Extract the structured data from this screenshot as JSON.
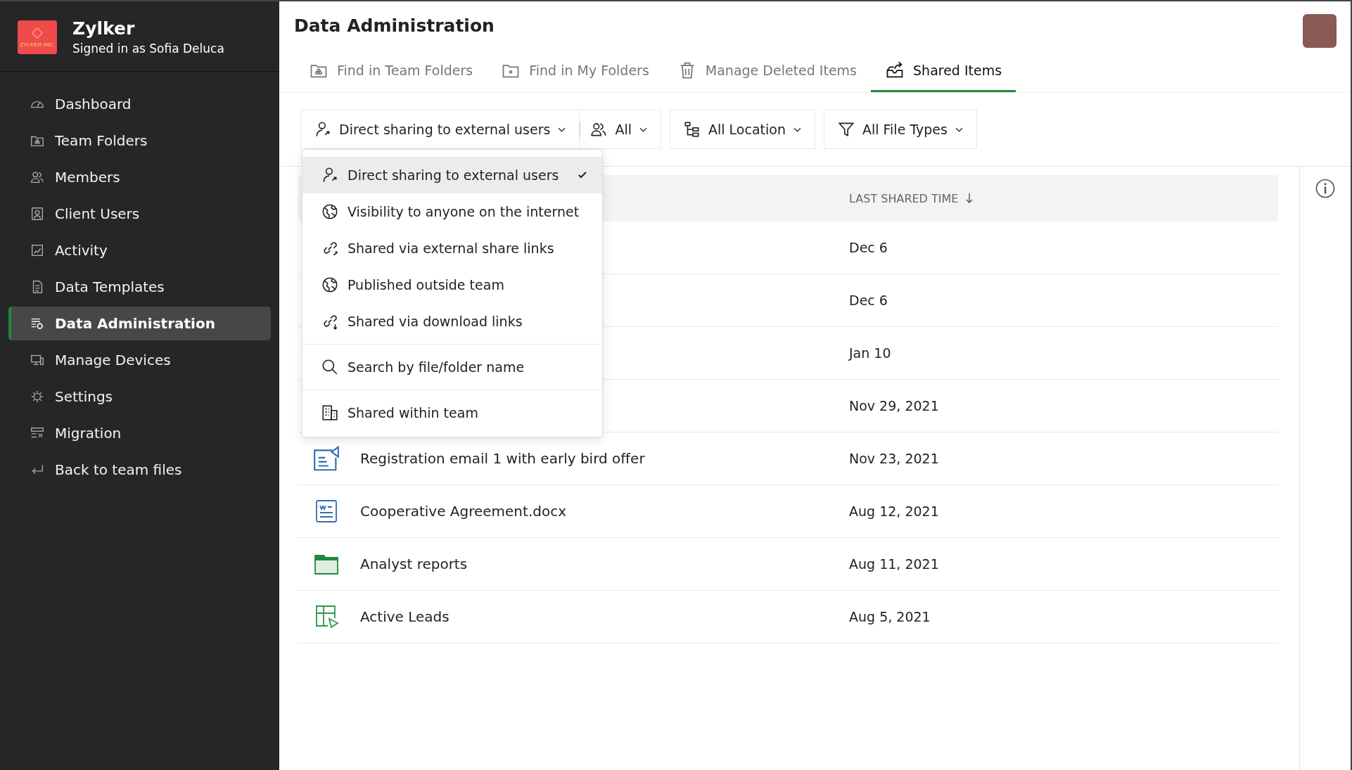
{
  "brand": {
    "logo_text": "ZYLKER INC.",
    "name": "Zylker",
    "signed_in": "Signed in as Sofia Deluca"
  },
  "sidebar": {
    "items": [
      {
        "label": "Dashboard",
        "kind": "gauge",
        "selected": false
      },
      {
        "label": "Team Folders",
        "kind": "teamfolder",
        "selected": false
      },
      {
        "label": "Members",
        "kind": "members",
        "selected": false
      },
      {
        "label": "Client Users",
        "kind": "user",
        "selected": false
      },
      {
        "label": "Activity",
        "kind": "chart",
        "selected": false
      },
      {
        "label": "Data Templates",
        "kind": "template",
        "selected": false
      },
      {
        "label": "Data Administration",
        "kind": "admin",
        "selected": true
      },
      {
        "label": "Manage Devices",
        "kind": "devices",
        "selected": false
      },
      {
        "label": "Settings",
        "kind": "gear",
        "selected": false
      },
      {
        "label": "Migration",
        "kind": "migration",
        "selected": false
      },
      {
        "label": "Back to team files",
        "kind": "back",
        "selected": false
      }
    ]
  },
  "page_title": "Data Administration",
  "tabs": [
    {
      "label": "Find in Team Folders",
      "kind": "teamfolder",
      "selected": false
    },
    {
      "label": "Find in My Folders",
      "kind": "folder",
      "selected": false
    },
    {
      "label": "Manage Deleted Items",
      "kind": "trash",
      "selected": false
    },
    {
      "label": "Shared Items",
      "kind": "share",
      "selected": true
    }
  ],
  "filters": [
    {
      "label": "Direct sharing to external users",
      "kind": "usershare",
      "joined": false
    },
    {
      "label": "All",
      "kind": "members",
      "joined": true
    },
    {
      "label": "All Location",
      "kind": "tree",
      "joined": false
    },
    {
      "label": "All File Types",
      "kind": "filter",
      "joined": false
    }
  ],
  "dropdown": {
    "groups": [
      [
        {
          "label": "Direct sharing to external users",
          "kind": "usershare",
          "selected": true
        },
        {
          "label": "Visibility to anyone on the internet",
          "kind": "globe",
          "selected": false
        },
        {
          "label": "Shared via external share links",
          "kind": "linkout",
          "selected": false
        },
        {
          "label": "Published outside team",
          "kind": "globe",
          "selected": false
        },
        {
          "label": "Shared via download links",
          "kind": "linkdown",
          "selected": false
        }
      ],
      [
        {
          "label": "Search by file/folder name",
          "kind": "search",
          "selected": false
        }
      ],
      [
        {
          "label": "Shared within team",
          "kind": "building",
          "selected": false
        }
      ]
    ]
  },
  "table": {
    "columns": [
      {
        "label": "LAST SHARED TIME",
        "sorted_descending": true
      }
    ],
    "rows": [
      {
        "last_shared_time": "Dec 6"
      },
      {
        "last_shared_time": "Dec 6"
      },
      {
        "last_shared_time": "Jan 10"
      },
      {
        "last_shared_time": "Nov 29, 2021"
      },
      {
        "kind": "email",
        "name": "Registration email 1 with early bird offer",
        "last_shared_time": "Nov 23, 2021"
      },
      {
        "kind": "document",
        "name": "Cooperative Agreement.docx",
        "last_shared_time": "Aug 12, 2021"
      },
      {
        "kind": "folder",
        "name": "Analyst reports",
        "last_shared_time": "Aug 11, 2021"
      },
      {
        "kind": "spreadsheet",
        "name": "Active Leads",
        "last_shared_time": "Aug 5, 2021"
      }
    ]
  }
}
